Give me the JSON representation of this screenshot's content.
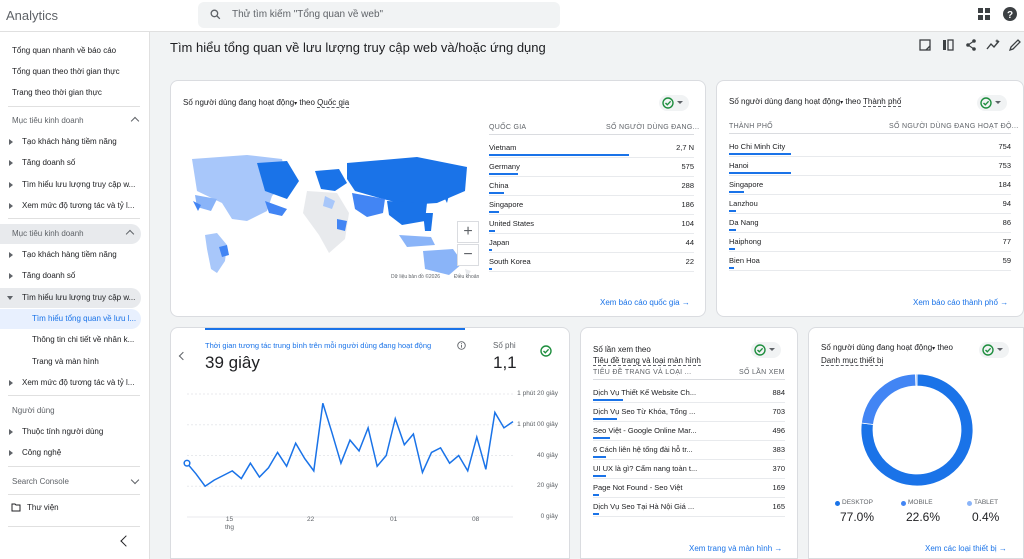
{
  "app": {
    "title": "Analytics"
  },
  "search": {
    "placeholder": "Thử tìm kiếm \"Tổng quan về web\""
  },
  "sidebar": {
    "items": [
      {
        "label": "Tổng quan nhanh về báo cáo"
      },
      {
        "label": "Tổng quan theo thời gian thực"
      },
      {
        "label": "Trang theo thời gian thực"
      },
      {
        "label": "Mục tiêu kinh doanh"
      },
      {
        "label": "Tạo khách hàng tiềm năng"
      },
      {
        "label": "Tăng doanh số"
      },
      {
        "label": "Tìm hiểu lưu lượng truy cập w..."
      },
      {
        "label": "Xem mức độ tương tác và tỷ l..."
      },
      {
        "label": "Mục tiêu kinh doanh"
      },
      {
        "label": "Tạo khách hàng tiềm năng"
      },
      {
        "label": "Tăng doanh số"
      },
      {
        "label": "Tìm hiểu lưu lượng truy cập w..."
      },
      {
        "label": "Tìm hiểu tổng quan về lưu l..."
      },
      {
        "label": "Thông tin chi tiết về nhân k..."
      },
      {
        "label": "Trang và màn hình"
      },
      {
        "label": "Xem mức độ tương tác và tỷ l..."
      },
      {
        "label": "Người dùng"
      },
      {
        "label": "Thuộc tính người dùng"
      },
      {
        "label": "Công nghệ"
      },
      {
        "label": "Search Console"
      },
      {
        "label": "Thư viện"
      }
    ]
  },
  "page": {
    "title": "Tìm hiểu tổng quan về lưu lượng truy cập web và/hoặc ứng dụng"
  },
  "country_card": {
    "title_a": "Số người dùng đang hoạt động",
    "title_b": " theo ",
    "title_c": "Quốc gia",
    "col1": "QUỐC GIA",
    "col2": "SỐ NGƯỜI DÙNG ĐANG...",
    "rows": [
      {
        "name": "Vietnam",
        "value": "2,7 N",
        "pct": 1.0
      },
      {
        "name": "Germany",
        "value": "575",
        "pct": 0.21
      },
      {
        "name": "China",
        "value": "288",
        "pct": 0.11
      },
      {
        "name": "Singapore",
        "value": "186",
        "pct": 0.07
      },
      {
        "name": "United States",
        "value": "104",
        "pct": 0.04
      },
      {
        "name": "Japan",
        "value": "44",
        "pct": 0.02
      },
      {
        "name": "South Korea",
        "value": "22",
        "pct": 0.01
      }
    ],
    "map_credit": "Dữ liệu bản đồ ©2026",
    "map_terms": "Điều khoản",
    "link": "Xem báo cáo quốc gia"
  },
  "city_card": {
    "title_a": "Số người dùng đang hoạt động",
    "title_b": " theo ",
    "title_c": "Thành phố",
    "col1": "THÀNH PHỐ",
    "col2": "SỐ NGƯỜI DÙNG ĐANG HOẠT ĐỘ...",
    "rows": [
      {
        "name": "Ho Chi Minh City",
        "value": "754",
        "pct": 1.0
      },
      {
        "name": "Hanoi",
        "value": "753",
        "pct": 1.0
      },
      {
        "name": "Singapore",
        "value": "184",
        "pct": 0.24
      },
      {
        "name": "Lanzhou",
        "value": "94",
        "pct": 0.12
      },
      {
        "name": "Da Nang",
        "value": "86",
        "pct": 0.11
      },
      {
        "name": "Haiphong",
        "value": "77",
        "pct": 0.1
      },
      {
        "name": "Bien Hoa",
        "value": "59",
        "pct": 0.08
      }
    ],
    "link": "Xem báo cáo thành phố"
  },
  "engagement_card": {
    "tab_active_label": "Thời gian tương tác trung bình trên mỗi người dùng đang hoạt động",
    "tab_active_value": "39 giây",
    "tab_other_label": "Số phi",
    "tab_other_value": "1,1",
    "y_ticks": [
      "1 phút 20 giây",
      "1 phút 00 giây",
      "40 giây",
      "20 giây",
      "0 giây"
    ],
    "x_ticks": [
      "15\nthg",
      "22",
      "01",
      "08"
    ]
  },
  "chart_data": {
    "type": "line",
    "title": "",
    "xlabel": "",
    "ylabel": "",
    "ylim": [
      0,
      80
    ],
    "y_ticks": [
      "0 giây",
      "20 giây",
      "40 giây",
      "1 phút 00 giây",
      "1 phút 20 giây"
    ],
    "series": [
      {
        "values": [
          35,
          28,
          20,
          24,
          27,
          30,
          25,
          35,
          26,
          32,
          42,
          33,
          48,
          38,
          30,
          74,
          55,
          35,
          50,
          43,
          58,
          33,
          40,
          64,
          47,
          54,
          29,
          42,
          45,
          35,
          40,
          30,
          52,
          31,
          68,
          58,
          62
        ]
      }
    ]
  },
  "pages_card": {
    "title_a": "Số lần xem theo",
    "title_b": "Tiêu đề trang và loại màn hình",
    "col1": "TIÊU ĐỀ TRANG VÀ LOẠI ...",
    "col2": "SỐ LẦN XEM",
    "rows": [
      {
        "name": "Dịch Vụ Thiết Kế Website Ch...",
        "value": "884",
        "pct": 1.0
      },
      {
        "name": "Dịch Vụ Seo Từ Khóa, Tổng ...",
        "value": "703",
        "pct": 0.8
      },
      {
        "name": "Seo Việt - Google Online Mar...",
        "value": "496",
        "pct": 0.56
      },
      {
        "name": "6 Cách liên hệ tổng đài hỗ tr...",
        "value": "383",
        "pct": 0.43
      },
      {
        "name": "UI UX là gì? Cẩm nang toàn t...",
        "value": "370",
        "pct": 0.42
      },
      {
        "name": "Page Not Found - Seo Việt",
        "value": "169",
        "pct": 0.19
      },
      {
        "name": "Dịch Vụ Seo Tại Hà Nội Giá ...",
        "value": "165",
        "pct": 0.19
      }
    ],
    "link": "Xem trang và màn hình"
  },
  "device_card": {
    "title_a": "Số người dùng đang hoạt động",
    "title_b": " theo",
    "title_c": "Danh mục thiết bị",
    "legend": [
      {
        "label": "DESKTOP",
        "value": "77.0%",
        "color": "#1a73e8"
      },
      {
        "label": "MOBILE",
        "value": "22.6%",
        "color": "#4285f4"
      },
      {
        "label": "TABLET",
        "value": "0.4%",
        "color": "#8ab4f8"
      }
    ],
    "link": "Xem các loại thiết bị"
  },
  "donut_data": {
    "type": "pie",
    "values": [
      77.0,
      22.6,
      0.4
    ],
    "categories": [
      "DESKTOP",
      "MOBILE",
      "TABLET"
    ],
    "colors": [
      "#1a73e8",
      "#4285f4",
      "#8ab4f8"
    ]
  },
  "colors": {
    "accent": "#1a73e8",
    "ok": "#1e8e3e"
  }
}
